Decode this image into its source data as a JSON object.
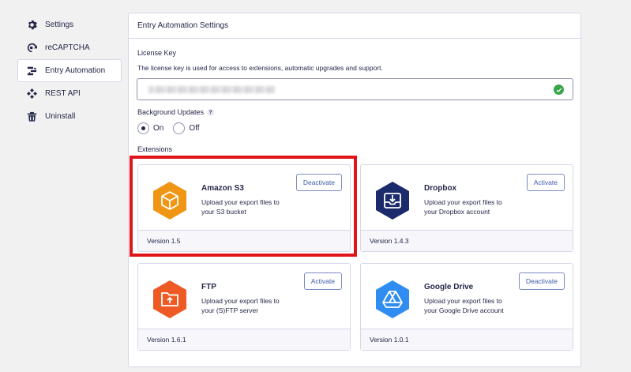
{
  "sidebar": {
    "items": [
      {
        "label": "Settings",
        "icon": "gear-icon"
      },
      {
        "label": "reCAPTCHA",
        "icon": "recaptcha-icon"
      },
      {
        "label": "Entry Automation",
        "icon": "entry-automation-icon",
        "active": true
      },
      {
        "label": "REST API",
        "icon": "rest-api-icon"
      },
      {
        "label": "Uninstall",
        "icon": "trash-icon"
      }
    ]
  },
  "panel": {
    "title": "Entry Automation Settings",
    "license": {
      "label": "License Key",
      "description": "The license key is used for access to extensions, automatic upgrades and support.",
      "status_icon": "check-circle-icon",
      "status_color": "#3aa54a"
    },
    "background_updates": {
      "label": "Background Updates",
      "help": "?",
      "options": [
        {
          "label": "On",
          "selected": true
        },
        {
          "label": "Off",
          "selected": false
        }
      ]
    },
    "extensions_label": "Extensions",
    "extensions": [
      {
        "name": "Amazon S3",
        "description": "Upload your export files to your S3 bucket",
        "button": "Deactivate",
        "version": "Version 1.5",
        "icon": "box-icon",
        "color": "#ef9615",
        "highlighted": true
      },
      {
        "name": "Dropbox",
        "description": "Upload your export files to your Dropbox account",
        "button": "Activate",
        "version": "Version 1.4.3",
        "icon": "download-tray-icon",
        "color": "#1b2a6b"
      },
      {
        "name": "FTP",
        "description": "Upload your export files to your (S)FTP server",
        "button": "Activate",
        "version": "Version 1.6.1",
        "icon": "folder-upload-icon",
        "color": "#ee5a24"
      },
      {
        "name": "Google Drive",
        "description": "Upload your export files to your Google Drive account",
        "button": "Deactivate",
        "version": "Version 1.0.1",
        "icon": "drive-triangle-icon",
        "color": "#2f8cf0"
      }
    ]
  },
  "colors": {
    "accent": "#3d5aa8",
    "highlight_border": "#e0141a"
  }
}
